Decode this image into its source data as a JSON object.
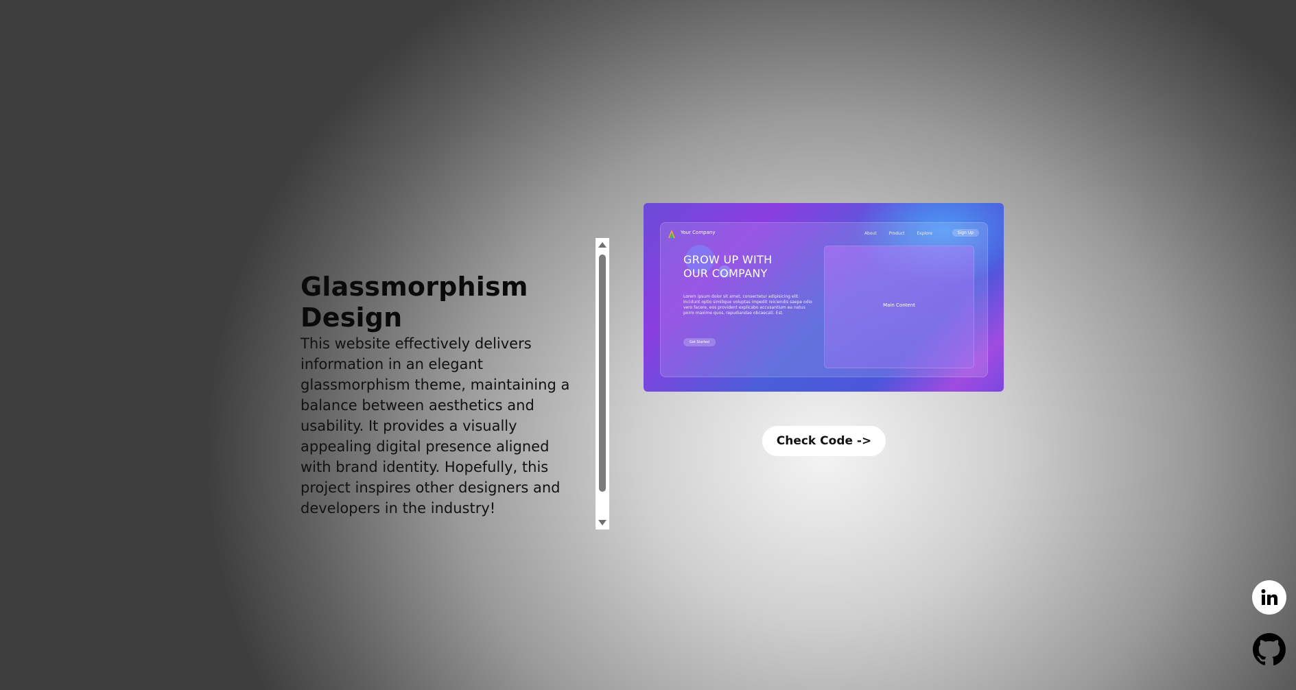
{
  "intro": {
    "title": "Glassmorphism Design",
    "description": "This website effectively delivers information in an elegant glassmorphism theme, maintaining a balance between aesthetics and usability. It provides a visually appealing digital presence aligned with brand identity. Hopefully, this project inspires other designers and developers in the industry!"
  },
  "preview": {
    "brand": "Your Company",
    "nav": [
      "About",
      "Product",
      "Explore"
    ],
    "signup": "Sign Up",
    "heading_line1": "GROW UP WITH",
    "heading_line2": "OUR COMPANY",
    "body": "Lorem ipsum dolor sit amet, consectetur adipisicing elit. Incidunt optio similique voluptas impedit reiciendis saepe odio vero facere, eos provident explicabo accusantium ea natus porro maxime quos, repudiandae obcaecati. Est.",
    "cta": "Get Started",
    "main_content": "Main Content"
  },
  "actions": {
    "check_code": "Check Code ->"
  },
  "social": {
    "linkedin_icon": "linkedin-icon",
    "github_icon": "github-icon"
  },
  "colors": {
    "preview_purple": "#8a3ee0",
    "preview_blue": "#4a5ed8",
    "button_bg": "#ffffff"
  }
}
